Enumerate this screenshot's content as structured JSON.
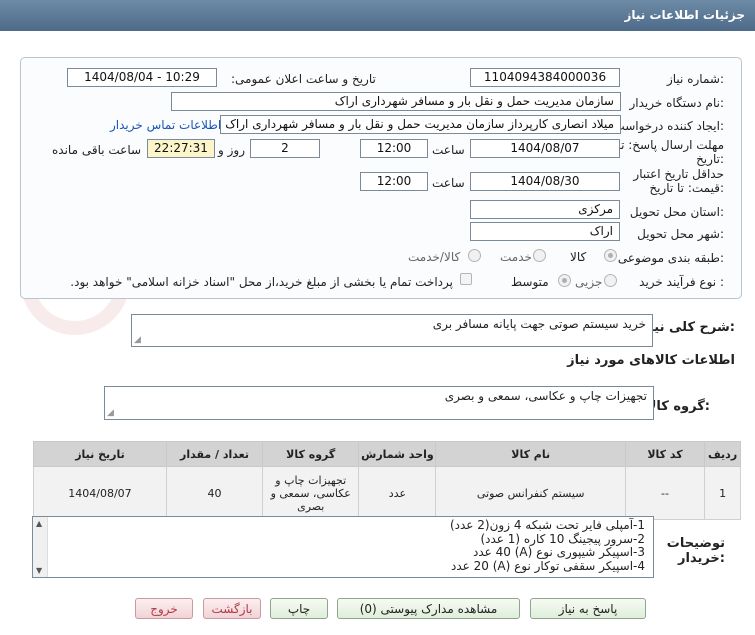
{
  "window": {
    "title": "جزئیات اطلاعات نیاز"
  },
  "form": {
    "need_number_label": "شماره نیاز:",
    "need_number": "1104094384000036",
    "announce_label": "تاریخ و ساعت اعلان عمومی:",
    "announce_value": "1404/08/04 - 10:29",
    "buyer_org_label": "نام دستگاه خریدار:",
    "buyer_org": "سازمان مدیریت حمل و نقل بار و مسافر شهرداری اراک",
    "creator_label": "ایجاد کننده درخواست:",
    "creator": "میلاد انصاری کارپرداز سازمان مدیریت حمل و نقل بار و مسافر شهرداری اراک",
    "contact_link": "اطلاعات تماس خریدار",
    "reply_deadline_label_1": "مهلت ارسال پاسخ: تا",
    "reply_deadline_label_2": "تاریخ:",
    "reply_date": "1404/08/07",
    "time_label": "ساعت",
    "reply_time": "12:00",
    "days_value": "2",
    "days_label": "روز و",
    "remaining_time": "22:27:31",
    "remaining_label": "ساعت باقی مانده",
    "price_validity_label_1": "حداقل تاریخ اعتبار",
    "price_validity_label_2": "قیمت: تا تاریخ:",
    "validity_date": "1404/08/30",
    "validity_time": "12:00",
    "province_label": "استان محل تحویل:",
    "province": "مرکزی",
    "city_label": "شهر محل تحویل:",
    "city": "اراک",
    "category_label": "طبقه بندی موضوعی:",
    "category_options": [
      "کالا",
      "خدمت",
      "کالا/خدمت"
    ],
    "process_label": "نوع فرآیند خرید :",
    "process_options": [
      "جزیی",
      "متوسط"
    ],
    "payment_note": "پرداخت تمام یا بخشی از مبلغ خرید،از محل \"اسناد خزانه اسلامی\" خواهد بود."
  },
  "summary": {
    "label": "شرح کلی نیاز:",
    "text": "خرید سیستم صوتی جهت پایانه مسافر بری"
  },
  "goods_info": {
    "title": "اطلاعات کالاهای مورد نیاز"
  },
  "goods_group": {
    "label": "گروه کالا:",
    "text": "تجهیزات چاپ و عکاسی، سمعی و بصری"
  },
  "table": {
    "headers": [
      "ردیف",
      "کد کالا",
      "نام کالا",
      "واحد شمارش",
      "گروه کالا",
      "تعداد / مقدار",
      "تاریخ نیاز"
    ],
    "rows": [
      {
        "row": "1",
        "code": "--",
        "name": "سیستم کنفرانس صوتی",
        "unit": "عدد",
        "group": "تجهیزات چاپ و عکاسی، سمعی و بصری",
        "qty": "40",
        "date": "1404/08/07"
      }
    ]
  },
  "buyer_notes": {
    "label_1": "توضیحات",
    "label_2": "خریدار:",
    "lines": [
      "1-آمپلی فایر تحت شبکه 4 زون(2 عدد)",
      "2-سرور پیجینگ 10 کاره (1 عدد)",
      "3-اسپیکر شیپوری نوع (A) 40 عدد",
      "4-اسپیکر سقفی توکار نوع (A) 20 عدد"
    ]
  },
  "buttons": {
    "reply": "پاسخ به نیاز",
    "attachments": "مشاهده مدارک پیوستی (0)",
    "print": "چاپ",
    "back": "بازگشت",
    "exit": "خروج"
  },
  "watermark": {
    "text": "AriaTender.neT"
  }
}
